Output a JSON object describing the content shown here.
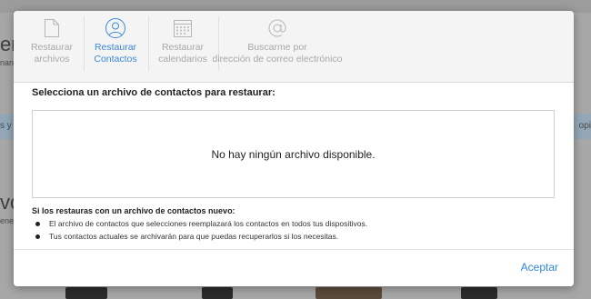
{
  "background": {
    "heading": "er",
    "sub": "nan",
    "strip_left": "s y",
    "strip_right": "opi",
    "heading2": "vc",
    "sub2": "ene"
  },
  "tabs": [
    {
      "label": "Restaurar\narchivos",
      "icon": "document-icon",
      "active": false
    },
    {
      "label": "Restaurar\nContactos",
      "icon": "contacts-icon",
      "active": true
    },
    {
      "label": "Restaurar\ncalendarios",
      "icon": "calendar-icon",
      "active": false
    },
    {
      "label": "Buscarme por\ndirección de correo electrónico",
      "icon": "at-sign-icon",
      "active": false
    }
  ],
  "main": {
    "title": "Selecciona un archivo de contactos para restaurar:",
    "empty_message": "No hay ningún archivo disponible.",
    "note_title": "Si los restauras con un archivo de contactos nuevo:",
    "notes": [
      "El archivo de contactos que selecciones reemplazará los contactos en todos tus dispositivos.",
      "Tus contactos actuales se archivarán para que puedas recuperarlos si los necesitas."
    ]
  },
  "footer": {
    "accept_label": "Aceptar"
  },
  "colors": {
    "accent": "#3a88d8",
    "inactive": "#a8a8a8"
  }
}
